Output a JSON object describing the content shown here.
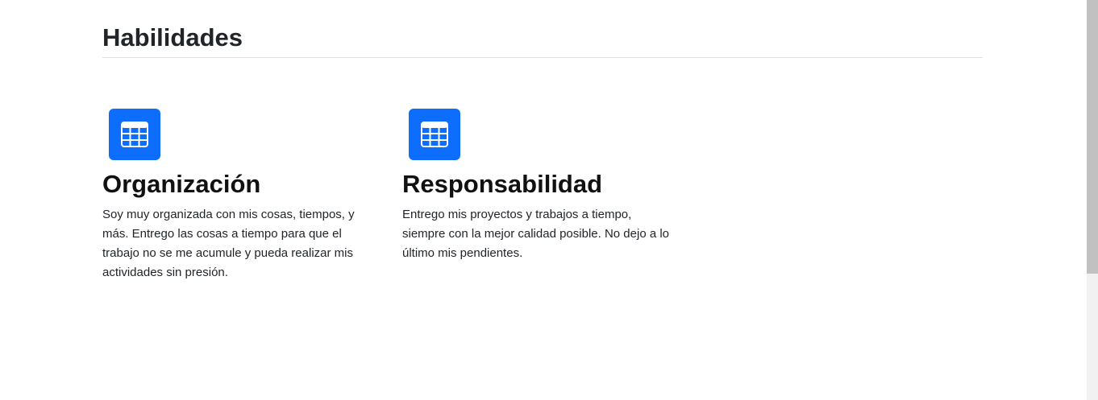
{
  "section": {
    "title": "Habilidades"
  },
  "features": [
    {
      "icon": "table-icon",
      "title": "Organización",
      "text": "Soy muy organizada con mis cosas, tiempos, y más. Entrego las cosas a tiempo para que el trabajo no se me acumule y pueda realizar mis actividades sin presión."
    },
    {
      "icon": "table-icon",
      "title": "Responsabilidad",
      "text": "Entrego mis proyectos y trabajos a tiempo, siempre con la mejor calidad posible. No dejo a lo último mis pendientes."
    }
  ],
  "colors": {
    "accent": "#0d6efd",
    "text": "#212529",
    "divider": "#dee2e6"
  }
}
